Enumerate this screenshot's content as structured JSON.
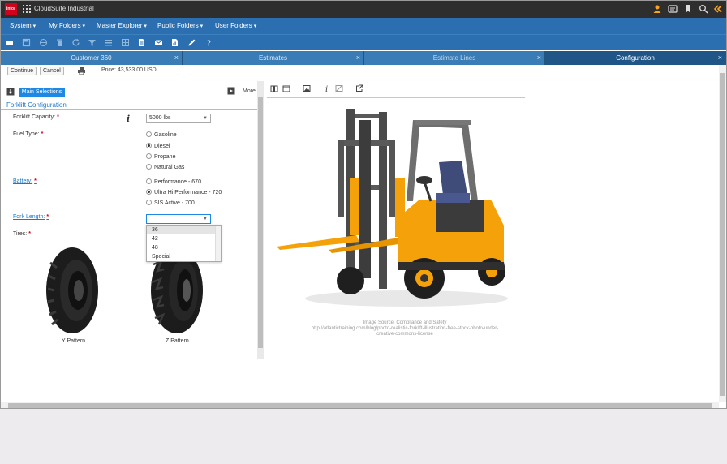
{
  "app": {
    "logo_text": "infor",
    "title": "CloudSuite Industrial"
  },
  "menu": [
    {
      "label": "System"
    },
    {
      "label": "My Folders"
    },
    {
      "label": "Master Explorer"
    },
    {
      "label": "Public Folders"
    },
    {
      "label": "User Folders"
    }
  ],
  "tabs": [
    {
      "label": "Customer 360",
      "close": "×"
    },
    {
      "label": "Estimates",
      "close": "×"
    },
    {
      "label": "Estimate Lines",
      "close": "×"
    },
    {
      "label": "Configuration",
      "close": "×"
    }
  ],
  "actions": {
    "continue": "Continue",
    "cancel": "Cancel",
    "price": "Price: 43,533.00 USD"
  },
  "section": {
    "tab": "Main Selections",
    "more": "More...",
    "title": "Forklift Configuration"
  },
  "form": {
    "capacity": {
      "label": "Forklift Capacity:",
      "req": "*",
      "value": "5000 lbs"
    },
    "fuel": {
      "label": "Fuel Type:",
      "req": "*",
      "options": [
        "Gasoline",
        "Diesel",
        "Propane",
        "Natural Gas"
      ],
      "selected": "Diesel"
    },
    "battery": {
      "label": "Battery:",
      "req": "*",
      "options": [
        "Performance - 670",
        "Ultra Hi Performance - 720",
        "SIS Active - 700"
      ],
      "selected": "Ultra Hi Performance - 720"
    },
    "fork": {
      "label": "Fork Length:",
      "req": "*",
      "value": "",
      "options": [
        "36",
        "42",
        "48",
        "Special"
      ],
      "highlighted": "36"
    },
    "tires": {
      "label": "Tires:",
      "req": "*",
      "options": [
        "Y Pattern",
        "Z Pattern"
      ]
    }
  },
  "image_credit": [
    "Image Source: Compliance and Safety",
    "http://atlantictraining.com/blog/photo-realistic-forklift-illustration-free-stock-photo-under-",
    "creative-commons-license"
  ],
  "colors": {
    "brand_red": "#d0021b",
    "menubar": "#2c6fb0",
    "tab_active": "#1f5687",
    "accent": "#1e88e5",
    "forklift": "#f5a20a"
  }
}
